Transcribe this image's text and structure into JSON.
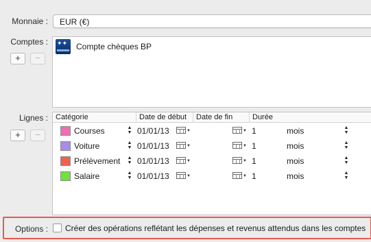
{
  "currency": {
    "label": "Monnaie :",
    "value": "EUR (€)"
  },
  "accounts": {
    "label": "Comptes :",
    "add_label": "+",
    "remove_label": "−",
    "items": [
      {
        "name": "Compte chèques BP",
        "icon": "banque-populaire-logo-icon"
      }
    ]
  },
  "lines": {
    "label": "Lignes :",
    "add_label": "+",
    "remove_label": "−",
    "columns": {
      "category": "Catégorie",
      "start": "Date de début",
      "end": "Date de fin",
      "duration": "Durée"
    },
    "rows": [
      {
        "category": "Courses",
        "color": "#f06fb4",
        "start": "01/01/13",
        "duration": "1",
        "unit": "mois"
      },
      {
        "category": "Voiture",
        "color": "#a98ce8",
        "start": "01/01/13",
        "duration": "1",
        "unit": "mois"
      },
      {
        "category": "Prélèvement",
        "color": "#f2614b",
        "start": "01/01/13",
        "duration": "1",
        "unit": "mois"
      },
      {
        "category": "Salaire",
        "color": "#6fe33a",
        "start": "01/01/13",
        "duration": "1",
        "unit": "mois"
      }
    ]
  },
  "options": {
    "label": "Options :",
    "checkbox_text": "Créer des opérations reflétant les dépenses et revenus attendus dans les comptes",
    "checked": false,
    "highlight_color": "#e55a4e"
  }
}
